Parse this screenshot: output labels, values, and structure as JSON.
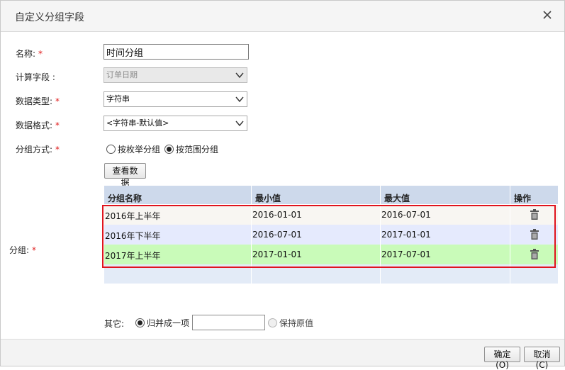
{
  "dialog": {
    "title": "自定义分组字段",
    "close_icon": "close-icon"
  },
  "form": {
    "name": {
      "label": "名称:",
      "required_mark": "*",
      "value": "时间分组"
    },
    "calc_field": {
      "label": "计算字段 :",
      "value": "订单日期",
      "disabled": true
    },
    "data_type": {
      "label": "数据类型:",
      "required_mark": "*",
      "value": "字符串"
    },
    "data_format": {
      "label": "数据格式:",
      "required_mark": "*",
      "value": "<字符串-默认值>"
    },
    "group_mode": {
      "label": "分组方式:",
      "required_mark": "*",
      "options": [
        {
          "label": "按枚举分组",
          "checked": false
        },
        {
          "label": "按范围分组",
          "checked": true
        }
      ]
    },
    "view_data_button": "查看数据"
  },
  "groups": {
    "label": "分组:",
    "required_mark": "*",
    "columns": [
      "分组名称",
      "最小值",
      "最大值",
      "操作"
    ],
    "rows": [
      {
        "name": "2016年上半年",
        "min": "2016-01-01",
        "max": "2016-07-01",
        "highlight": "#f8f6f2"
      },
      {
        "name": "2016年下半年",
        "min": "2016-07-01",
        "max": "2017-01-01",
        "highlight": "#e5eafd"
      },
      {
        "name": "2017年上半年",
        "min": "2017-01-01",
        "max": "2017-07-01",
        "highlight": "#c9fbb9"
      }
    ],
    "delete_icon": "trash-icon",
    "selection_outline_color": "#e0141e"
  },
  "others": {
    "label": "其它:",
    "options": [
      {
        "label": "归并成一项",
        "checked": true
      },
      {
        "label": "保持原值",
        "checked": false
      }
    ],
    "merge_input_value": ""
  },
  "footer": {
    "ok_button": "确定(O)",
    "cancel_button": "取消(C)"
  }
}
